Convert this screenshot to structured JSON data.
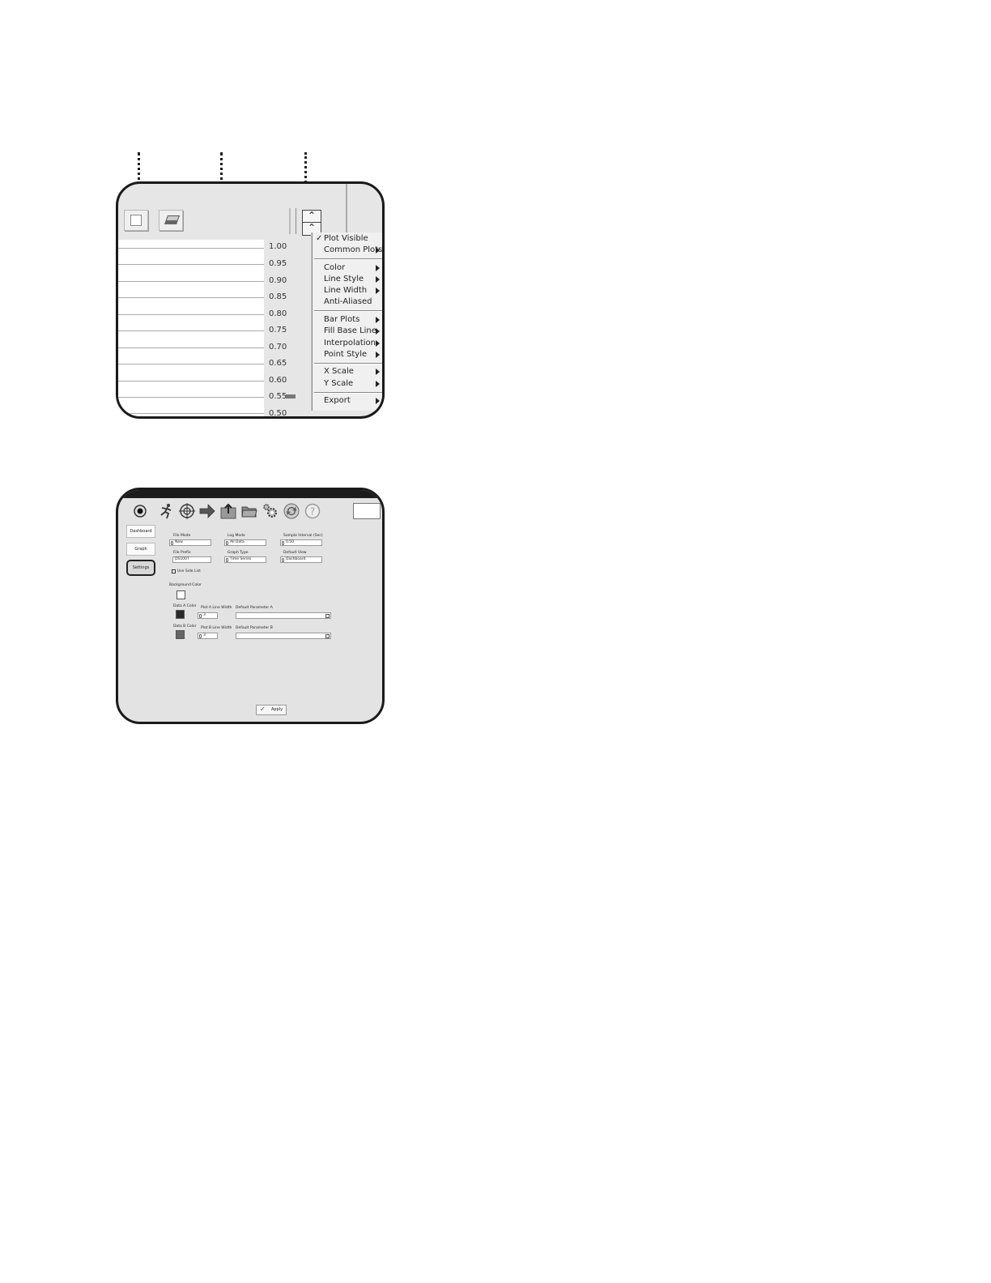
{
  "panel1": {
    "y_ticks": [
      "1.00",
      "0.95",
      "0.90",
      "0.85",
      "0.80",
      "0.75",
      "0.70",
      "0.65",
      "0.60",
      "0.55",
      "0.50"
    ],
    "context_menu": {
      "items": [
        {
          "label": "Plot Visible",
          "checked": true,
          "submenu": false
        },
        {
          "label": "Common Plots",
          "checked": false,
          "submenu": true
        },
        {
          "label": "Color",
          "checked": false,
          "submenu": true
        },
        {
          "label": "Line Style",
          "checked": false,
          "submenu": true
        },
        {
          "label": "Line Width",
          "checked": false,
          "submenu": true
        },
        {
          "label": "Anti-Aliased",
          "checked": false,
          "submenu": false
        },
        {
          "label": "Bar Plots",
          "checked": false,
          "submenu": true
        },
        {
          "label": "Fill Base Line",
          "checked": false,
          "submenu": true
        },
        {
          "label": "Interpolation",
          "checked": false,
          "submenu": true
        },
        {
          "label": "Point Style",
          "checked": false,
          "submenu": true
        },
        {
          "label": "X Scale",
          "checked": false,
          "submenu": true
        },
        {
          "label": "Y Scale",
          "checked": false,
          "submenu": true
        },
        {
          "label": "Export",
          "checked": false,
          "submenu": true
        }
      ],
      "checkmark": "✓"
    },
    "series_color": "#777777"
  },
  "panel2": {
    "toolbar_icons": [
      "record-icon",
      "run-icon",
      "target-icon",
      "arrow-right-icon",
      "export-icon",
      "folder-icon",
      "gears-icon",
      "refresh-icon",
      "help-icon"
    ],
    "nav": {
      "dashboard": "Dashboard",
      "graph": "Graph",
      "settings": "Settings"
    },
    "fields": {
      "file_mode": {
        "label": "File Mode",
        "value": "New"
      },
      "log_mode": {
        "label": "Log Mode",
        "value": "All Data"
      },
      "sample_interval": {
        "label": "Sample Interval (Sec)",
        "value": "0.50"
      },
      "file_prefix": {
        "label": "File Prefix",
        "value": "DS100T"
      },
      "graph_type": {
        "label": "Graph Type",
        "value": "Time Series"
      },
      "default_view": {
        "label": "Default View",
        "value": "Dashboard"
      },
      "use_side_list": {
        "label": "Use Side List",
        "checked": false
      },
      "background_color": {
        "label": "Background Color",
        "color": "#ffffff"
      },
      "data_a_color": {
        "label": "Data A Color",
        "color": "#2a2a2a"
      },
      "plot_a_line_width": {
        "label": "Plot A Line Width",
        "value": "3"
      },
      "default_parameter_a": {
        "label": "Default Parameter A",
        "value": ""
      },
      "data_b_color": {
        "label": "Data B Color",
        "color": "#666666"
      },
      "plot_b_line_width": {
        "label": "Plot B Line Width",
        "value": "3"
      },
      "default_parameter_b": {
        "label": "Default Parameter B",
        "value": ""
      }
    },
    "apply_label": "Apply"
  }
}
